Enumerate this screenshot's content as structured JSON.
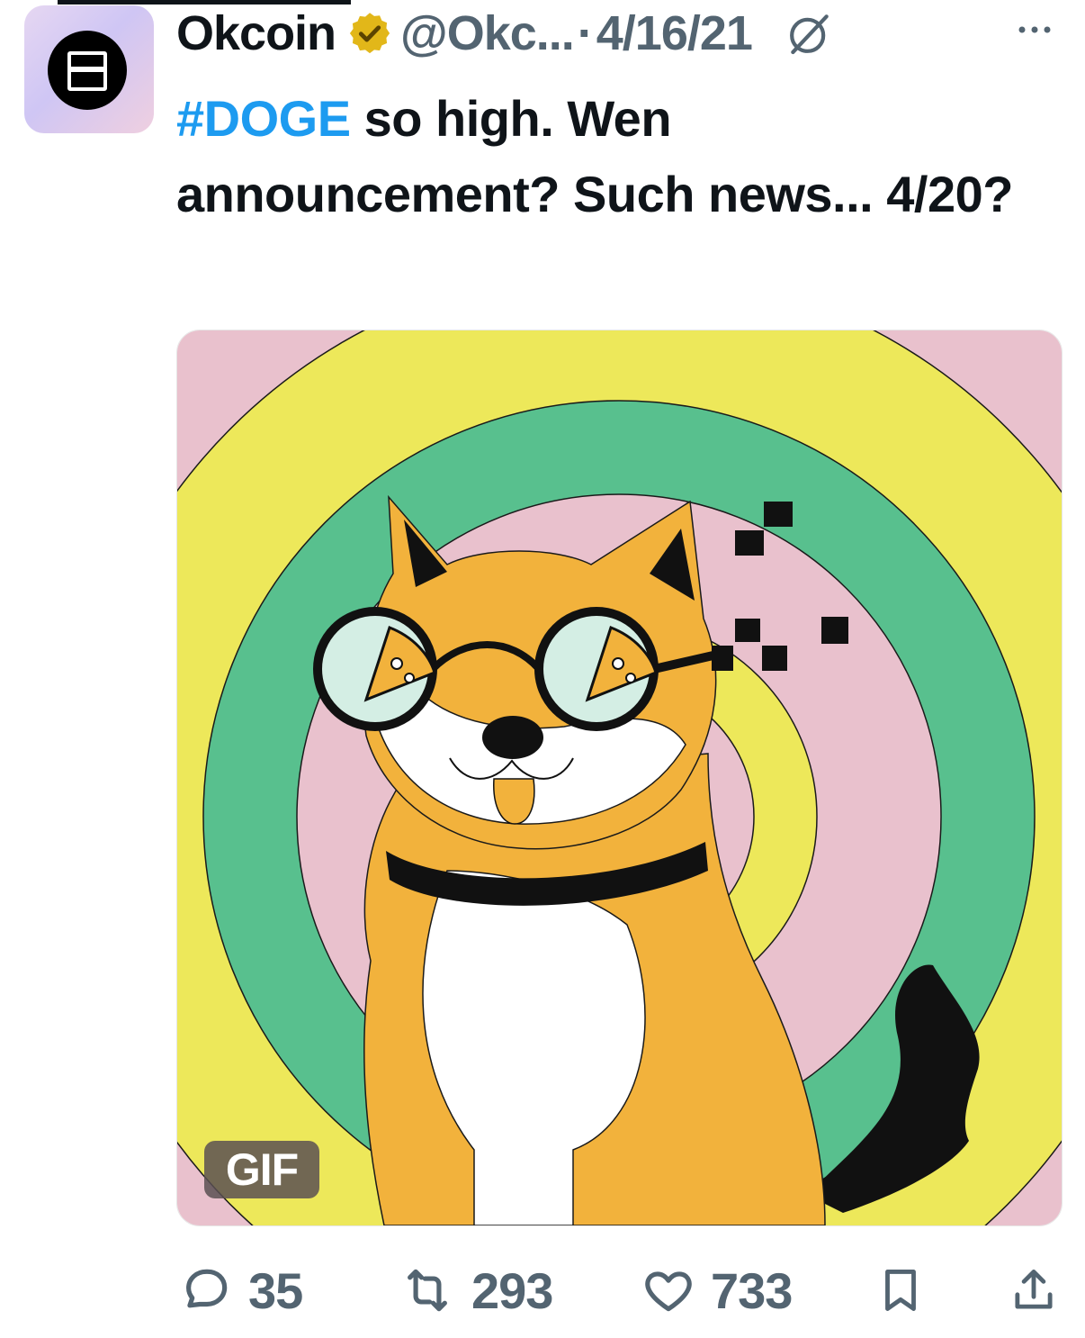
{
  "tweet": {
    "author_name": "Okcoin",
    "handle": "@Okc...",
    "separator": "·",
    "date": "4/16/21",
    "text_hashtag": "#DOGE",
    "text_rest": " so high. Wen announcement? Such news... 4/20?"
  },
  "media": {
    "type_badge": "GIF",
    "colors": {
      "pink": "#e9c1cd",
      "yellow": "#ede85a",
      "green": "#58c08e",
      "dog_orange": "#f2b23c"
    }
  },
  "stats": {
    "replies": "35",
    "reposts": "293",
    "likes": "733"
  },
  "icons": [
    "verified-badge-icon",
    "grok-icon",
    "more-icon",
    "reply-icon",
    "repost-icon",
    "like-icon",
    "bookmark-icon",
    "share-icon"
  ]
}
